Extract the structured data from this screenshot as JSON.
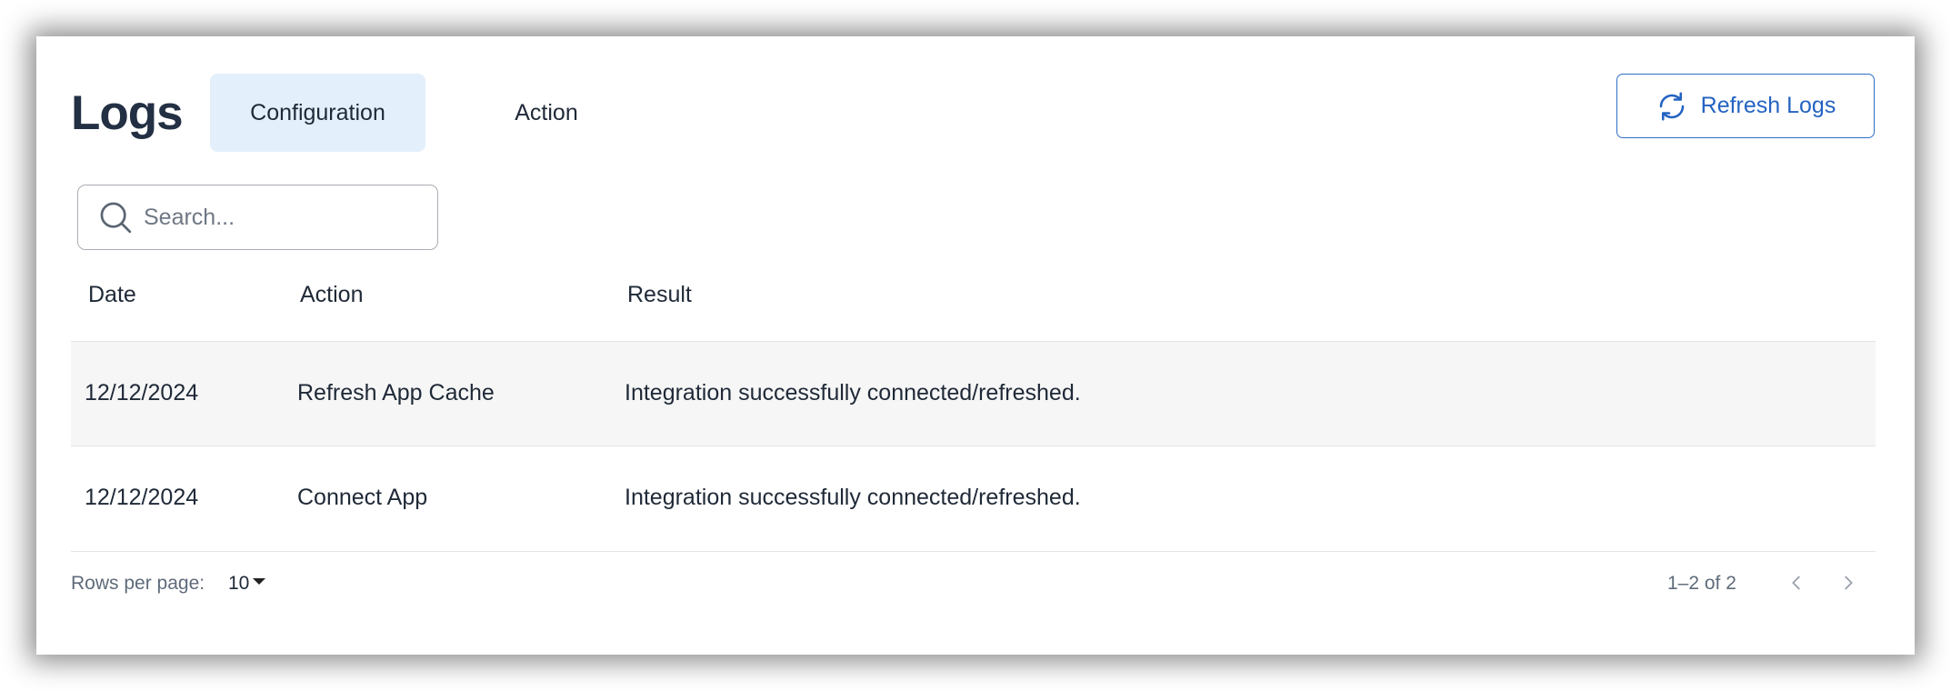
{
  "header": {
    "title": "Logs",
    "tabs": [
      {
        "label": "Configuration",
        "active": true
      },
      {
        "label": "Action",
        "active": false
      }
    ],
    "refresh_label": "Refresh Logs"
  },
  "search": {
    "placeholder": "Search...",
    "value": "",
    "icon": "search-icon"
  },
  "table": {
    "columns": [
      "Date",
      "Action",
      "Result"
    ],
    "rows": [
      {
        "date": "12/12/2024",
        "action": "Refresh App Cache",
        "result": "Integration successfully connected/refreshed."
      },
      {
        "date": "12/12/2024",
        "action": "Connect App",
        "result": "Integration successfully connected/refreshed."
      }
    ]
  },
  "footer": {
    "rows_per_page_label": "Rows per page:",
    "rows_per_page_value": "10",
    "range_text": "1–2 of 2"
  },
  "colors": {
    "accent": "#2463c2",
    "active_tab_bg": "#e3f0fc",
    "title": "#233044",
    "row_shade": "#f6f6f6"
  }
}
